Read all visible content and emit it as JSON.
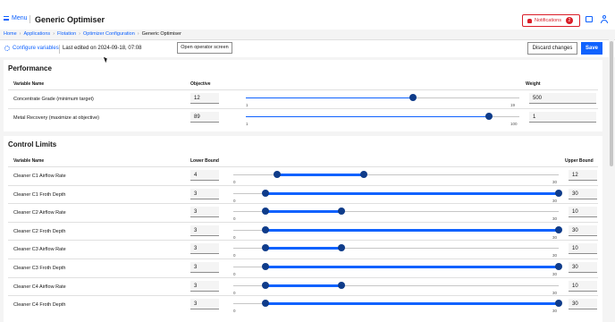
{
  "header": {
    "menu_label": "Menu",
    "app_title": "Generic Optimiser",
    "notifications_label": "Notifications",
    "notifications_count": "2"
  },
  "breadcrumb": [
    "Home",
    "Applications",
    "Flotation",
    "Optimizer Configuration",
    "Generic Optimiser"
  ],
  "toolbar": {
    "configure_label": "Configure variables",
    "last_edited": "Last edited on 2024-09-18, 07:08",
    "operator_button": "Open operator screen",
    "discard_button": "Discard changes",
    "save_button": "Save"
  },
  "performance": {
    "title": "Performance",
    "col_variable": "Variable Name",
    "col_objective": "Objective",
    "col_weight": "Weight",
    "rows": [
      {
        "name": "Concentrate Grade (minimum target)",
        "objective": "12",
        "min": "1",
        "max": "19",
        "value": 12,
        "weight": "500"
      },
      {
        "name": "Metal Recovery (maximize at objective)",
        "objective": "89",
        "min": "1",
        "max": "100",
        "value": 89,
        "weight": "1"
      }
    ]
  },
  "control_limits": {
    "title": "Control Limits",
    "col_variable": "Variable Name",
    "col_lower": "Lower Bound",
    "col_upper": "Upper Bound",
    "rows": [
      {
        "name": "Cleaner C1 Airflow Rate",
        "lower": "4",
        "upper": "12",
        "min": "0",
        "max": "30",
        "lo": 4,
        "hi": 12
      },
      {
        "name": "Cleaner C1 Froth Depth",
        "lower": "3",
        "upper": "30",
        "min": "0",
        "max": "30",
        "lo": 3,
        "hi": 30
      },
      {
        "name": "Cleaner C2 Airflow Rate",
        "lower": "3",
        "upper": "10",
        "min": "0",
        "max": "30",
        "lo": 3,
        "hi": 10
      },
      {
        "name": "Cleaner C2 Froth Depth",
        "lower": "3",
        "upper": "30",
        "min": "0",
        "max": "30",
        "lo": 3,
        "hi": 30
      },
      {
        "name": "Cleaner C3 Airflow Rate",
        "lower": "3",
        "upper": "10",
        "min": "0",
        "max": "30",
        "lo": 3,
        "hi": 10
      },
      {
        "name": "Cleaner C3 Froth Depth",
        "lower": "3",
        "upper": "30",
        "min": "0",
        "max": "30",
        "lo": 3,
        "hi": 30
      },
      {
        "name": "Cleaner C4 Airflow Rate",
        "lower": "3",
        "upper": "10",
        "min": "0",
        "max": "30",
        "lo": 3,
        "hi": 10
      },
      {
        "name": "Cleaner C4 Froth Depth",
        "lower": "3",
        "upper": "30",
        "min": "0",
        "max": "30",
        "lo": 3,
        "hi": 30
      }
    ]
  },
  "colors": {
    "accent": "#0f62fe",
    "danger": "#da1e28",
    "thumb": "#0f3c8a"
  }
}
